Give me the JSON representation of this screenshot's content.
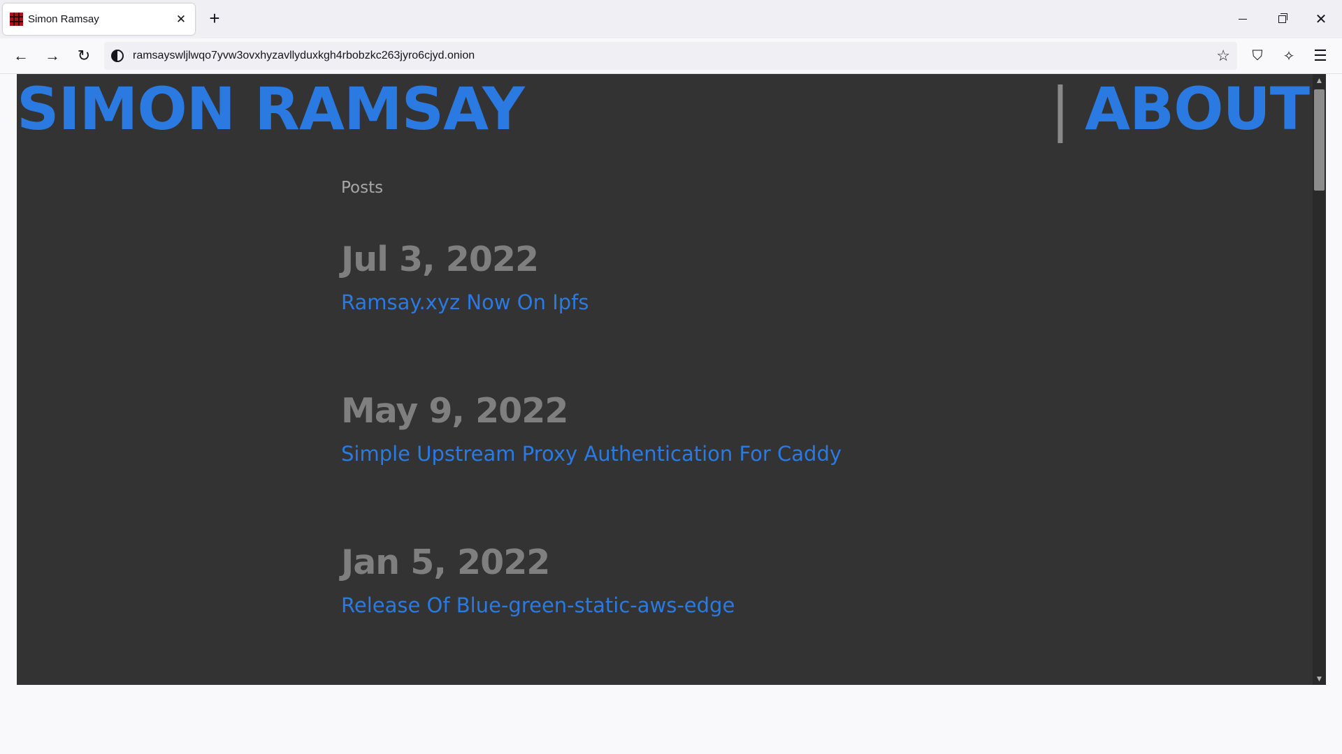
{
  "browser": {
    "tab": {
      "title": "Simon Ramsay",
      "close_glyph": "✕",
      "favicon": "tartan-favicon-icon"
    },
    "new_tab_glyph": "+",
    "window_controls": {
      "close_glyph": "✕"
    },
    "nav": {
      "back_glyph": "←",
      "forward_glyph": "→",
      "reload_glyph": "↻"
    },
    "url": "ramsayswljlwqo7yvw3ovxhyzavllyduxkgh4rbobzkc263jyro6cjyd.onion",
    "toolbar": {
      "bookmark_glyph": "☆",
      "shield_glyph": "⛉",
      "magic_glyph": "✧",
      "menu_glyph": "☰"
    }
  },
  "page": {
    "site_title": "SIMON RAMSAY",
    "nav_separator": "|",
    "nav_about": "ABOUT",
    "section_title": "Posts",
    "posts": [
      {
        "date": "Jul 3, 2022",
        "title": "Ramsay.xyz Now On Ipfs"
      },
      {
        "date": "May 9, 2022",
        "title": "Simple Upstream Proxy Authentication For Caddy"
      },
      {
        "date": "Jan 5, 2022",
        "title": "Release Of Blue-green-static-aws-edge"
      }
    ]
  },
  "scrollbar": {
    "up_glyph": "▲",
    "down_glyph": "▼"
  },
  "colors": {
    "accent": "#2a7ae2",
    "page_background": "#333333",
    "date_text": "#7f7f7f",
    "muted_text": "#a8a8a8"
  }
}
